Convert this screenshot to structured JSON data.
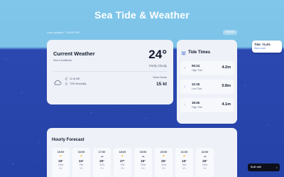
{
  "header": {
    "title": "Sea Tide & Weather",
    "last_updated": "Last updated: 7:05:46 PM",
    "refresh_label": "Refresh"
  },
  "tide_badge": {
    "line1": "Tide: 74.4%",
    "line2": "Sea Level"
  },
  "current_weather": {
    "title": "Current Weather",
    "subtitle": "Sea Conditions",
    "temperature": "24°",
    "condition": "Partly Cloudy",
    "wind": "11 kt NE",
    "humidity": "73% Humidity",
    "gust_label": "Wind Gusts",
    "gust_value": "15 kt"
  },
  "tide_times": {
    "title": "Tide Times",
    "rows": [
      {
        "time": "06:24",
        "kind": "High Tide",
        "height": "4.2m",
        "direction": "up"
      },
      {
        "time": "12:18",
        "kind": "Low Tide",
        "height": "0.8m",
        "direction": "down"
      },
      {
        "time": "18:45",
        "kind": "High Tide",
        "height": "4.1m",
        "direction": "up"
      }
    ]
  },
  "hourly_forecast": {
    "title": "Hourly Forecast",
    "hours": [
      {
        "time": "15:00",
        "icon": "sun-icon",
        "temp": "19°",
        "wind": "16 kt",
        "pct": "6%"
      },
      {
        "time": "16:00",
        "icon": "sun-icon",
        "temp": "24°",
        "wind": "9 kt",
        "pct": "5%"
      },
      {
        "time": "17:00",
        "icon": "cloud-icon",
        "temp": "25°",
        "wind": "11 kt",
        "pct": "7%"
      },
      {
        "time": "18:00",
        "icon": "sun-icon",
        "temp": "27°",
        "wind": "9 kt",
        "pct": "5%"
      },
      {
        "time": "19:00",
        "icon": "cloud-icon",
        "temp": "19°",
        "wind": "15 kt",
        "pct": "8%"
      },
      {
        "time": "20:00",
        "icon": "sun-icon",
        "temp": "25°",
        "wind": "13 kt",
        "pct": "5%"
      },
      {
        "time": "21:00",
        "icon": "sun-icon",
        "temp": "16°",
        "wind": "8 kt",
        "pct": "6%"
      },
      {
        "time": "22:00",
        "icon": "cloud-icon",
        "temp": "25°",
        "wind": "16 kt",
        "pct": "9%"
      }
    ]
  },
  "built_with": {
    "label": "Built with",
    "close": "×"
  },
  "colors": {
    "sky": "#7ec3e8",
    "sea": "#2542a8",
    "card": "#eef1f8",
    "accent": "#5b7bd8"
  }
}
